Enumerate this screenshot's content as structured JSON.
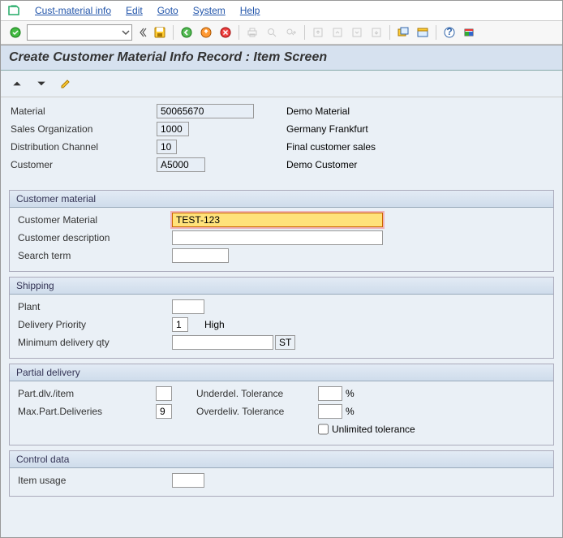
{
  "menu": {
    "items": [
      "Cust-material info",
      "Edit",
      "Goto",
      "System",
      "Help"
    ]
  },
  "title": "Create Customer Material Info Record : Item Screen",
  "dropdown": {
    "value": ""
  },
  "header": {
    "material": {
      "label": "Material",
      "value": "50065670",
      "desc": "Demo Material"
    },
    "salesorg": {
      "label": "Sales Organization",
      "value": "1000",
      "desc": "Germany Frankfurt"
    },
    "channel": {
      "label": "Distribution Channel",
      "value": "10",
      "desc": "Final customer sales"
    },
    "customer": {
      "label": "Customer",
      "value": "A5000",
      "desc": "Demo Customer"
    }
  },
  "groups": {
    "custmat": {
      "title": "Customer material",
      "fields": {
        "material": {
          "label": "Customer Material",
          "value": "TEST-123"
        },
        "desc": {
          "label": "Customer description",
          "value": ""
        },
        "search": {
          "label": "Search term",
          "value": ""
        }
      }
    },
    "shipping": {
      "title": "Shipping",
      "fields": {
        "plant": {
          "label": "Plant",
          "value": ""
        },
        "priority": {
          "label": "Delivery Priority",
          "value": "1",
          "desc": "High"
        },
        "minqty": {
          "label": "Minimum delivery qty",
          "value": "",
          "unit": "ST"
        }
      }
    },
    "partial": {
      "title": "Partial delivery",
      "left": {
        "partdlv": {
          "label": "Part.dlv./item",
          "value": ""
        },
        "maxpart": {
          "label": "Max.Part.Deliveries",
          "value": "9"
        }
      },
      "right": {
        "under": {
          "label": "Underdel. Tolerance",
          "value": "",
          "unit": "%"
        },
        "over": {
          "label": "Overdeliv. Tolerance",
          "value": "",
          "unit": "%"
        },
        "unlimited": {
          "label": "Unlimited tolerance"
        }
      }
    },
    "control": {
      "title": "Control data",
      "fields": {
        "usage": {
          "label": "Item usage",
          "value": ""
        }
      }
    }
  }
}
